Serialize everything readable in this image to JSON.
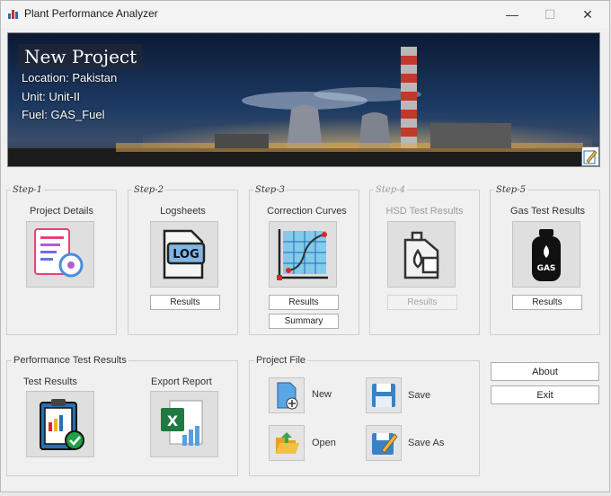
{
  "window": {
    "title": "Plant Performance Analyzer",
    "minimize": "—",
    "maximize": "☐",
    "close": "✕"
  },
  "banner": {
    "project_name": "New Project",
    "location": "Location: Pakistan",
    "unit": "Unit: Unit-II",
    "fuel": "Fuel: GAS_Fuel"
  },
  "steps": [
    {
      "label": "Step-1",
      "title": "Project Details",
      "enabled": true
    },
    {
      "label": "Step-2",
      "title": "Logsheets",
      "results": "Results",
      "enabled": true
    },
    {
      "label": "Step-3",
      "title": "Correction Curves",
      "results": "Results",
      "summary": "Summary",
      "enabled": true
    },
    {
      "label": "Step-4",
      "title": "HSD Test Results",
      "results": "Results",
      "enabled": false
    },
    {
      "label": "Step-5",
      "title": "Gas Test Results",
      "results": "Results",
      "enabled": true
    }
  ],
  "performance": {
    "group": "Performance Test Results",
    "test_results": "Test Results",
    "export_report": "Export Report",
    "log_icon_text": "LOG",
    "gas_icon_text": "GAS"
  },
  "project_file": {
    "group": "Project File",
    "new": "New",
    "open": "Open",
    "save": "Save",
    "save_as": "Save As"
  },
  "side": {
    "about": "About",
    "exit": "Exit"
  }
}
